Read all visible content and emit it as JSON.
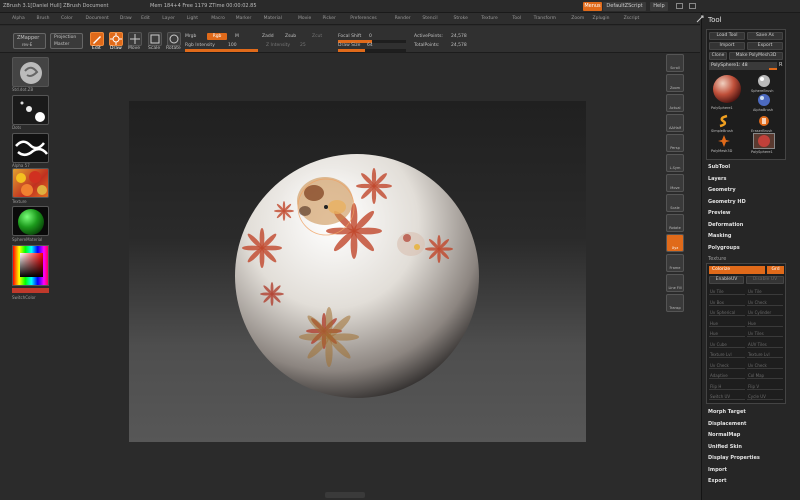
{
  "window": {
    "title": "ZBrush  3.1[Daniel Hull]   ZBrush Document",
    "stats": "Mem 184+4  Free 1179  ZTime 00:00:02.85",
    "menus_button": "Menus",
    "default_zscript": "DefaultZScript",
    "help": "Help"
  },
  "menubar": [
    "Alpha",
    "Brush",
    "Color",
    "Document",
    "Draw",
    "Edit",
    "Layer",
    "Light",
    "Macro",
    "Marker",
    "Material",
    "Movie",
    "Picker",
    "Preferences",
    "Render",
    "Stencil",
    "Stroke",
    "Texture",
    "Tool",
    "Transform",
    "Zoom",
    "Zplugin",
    "Zscript"
  ],
  "toolbar": {
    "zmapper": "ZMapper",
    "zmapper_sub": "rev-E",
    "projection": "Projection",
    "projection_sub": "Master",
    "edit": "Edit",
    "draw": "Draw",
    "move": "Move",
    "scale": "Scale",
    "rotate": "Rotate",
    "mrgb": "Mrgb",
    "rgb": "Rgb",
    "m": "M",
    "rgb_intensity_label": "Rgb Intensity",
    "rgb_intensity": "100",
    "zadd": "Zadd",
    "zsub": "Zsub",
    "zcut": "Zcut",
    "z_intensity_label": "Z Intensity",
    "z_intensity": "25",
    "focal_shift_label": "Focal Shift",
    "focal_shift": "0",
    "draw_size_label": "Draw Size",
    "draw_size": "64",
    "active_points_label": "ActivePoints:",
    "active_points": "24,578",
    "total_points_label": "TotalPoints:",
    "total_points": "24,578",
    "rgb_intensity_level": 1.0,
    "focal_shift_level": 0.5,
    "draw_size_level": 0.4
  },
  "left_shelf": {
    "items": [
      {
        "label": "Std.dot.ZB"
      },
      {
        "label": "Dots"
      },
      {
        "label": "Alpha 57"
      },
      {
        "label": "Texture"
      },
      {
        "label": "SphereMaterial"
      }
    ],
    "switch_color": "SwitchColor"
  },
  "right_strip": [
    {
      "label": "Scroll"
    },
    {
      "label": "Zoom"
    },
    {
      "label": "Actual"
    },
    {
      "label": "AAHalf"
    },
    {
      "label": "Persp"
    },
    {
      "label": "L.Sym"
    },
    {
      "label": "Move"
    },
    {
      "label": "Scale"
    },
    {
      "label": "Rotate"
    },
    {
      "label": "Xyz"
    },
    {
      "label": "Frame"
    },
    {
      "label": "Line Fill"
    },
    {
      "label": "Transp"
    }
  ],
  "tool_panel": {
    "title": "Tool",
    "load_tool": "Load Tool",
    "save_as": "Save As",
    "import": "Import",
    "export": "Export",
    "clone": "Clone",
    "make_polymesh": "Make PolyMesh3D",
    "polysphere": "PolySphere1: 48",
    "r": "R",
    "brushes": [
      {
        "label": "PolySphere1"
      },
      {
        "label": "SphereBrush"
      },
      {
        "label": "AlphaBrush"
      },
      {
        "label": "SimpleBrush"
      },
      {
        "label": "EraserBrush"
      },
      {
        "label": "PolyMesh3D"
      },
      {
        "label": "PolySphere1"
      }
    ],
    "sections": [
      "SubTool",
      "Layers",
      "Geometry",
      "Geometry HD",
      "Preview",
      "Deformation",
      "Masking",
      "Polygroups"
    ],
    "texture_label": "Texture",
    "colorize": "Colorize",
    "grd": "Grd",
    "enable_uv": "EnableUV",
    "disable_uv": "Disable UV",
    "texture_buttons": [
      "Uv Tile",
      "Uv Tile",
      "Uv Box",
      "Uv Check",
      "Uv Spherical",
      "Uv Cylinder",
      "Hue",
      "Hue",
      "Hue",
      "Uv Tiles",
      "Uv Cube",
      "AUV Tiles",
      "Texture Lvl",
      "Texture Lvl",
      "Uv Check",
      "Uv Check",
      "Adaptive",
      "Col Map",
      "Flip H",
      "Flip V",
      "Switch UV",
      "Cycle UV"
    ],
    "sections_bottom": [
      "Morph Target",
      "Displacement",
      "NormalMap",
      "Unified Skin",
      "Display Properties",
      "Import",
      "Export"
    ]
  },
  "colors": {
    "accent": "#e06a1a",
    "panel_bg": "#262626",
    "canvas_top": "#202020",
    "canvas_bottom": "#575757",
    "sphere_base": "#e8e4de",
    "flower_red": "#c0462a"
  },
  "icons": [
    "edit-icon",
    "draw-icon",
    "move-icon",
    "scale-icon",
    "rotate-icon",
    "tool-icon"
  ]
}
